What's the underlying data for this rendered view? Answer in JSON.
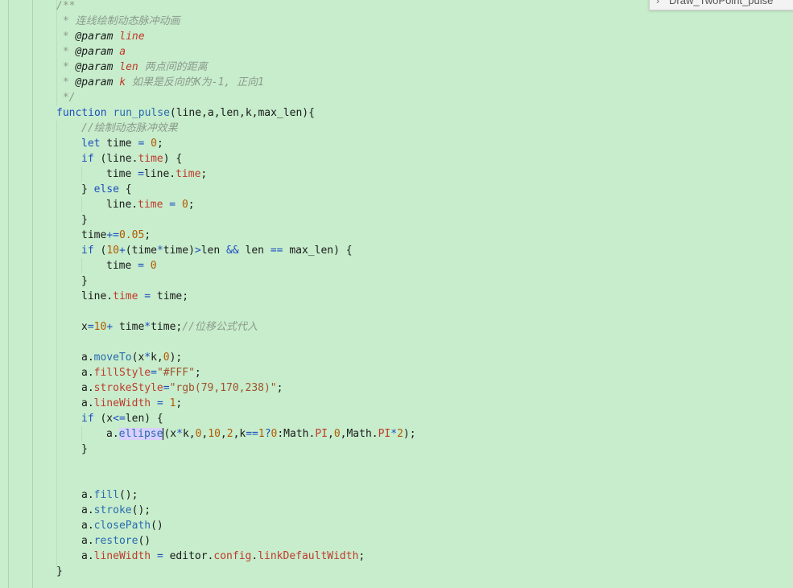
{
  "tab": {
    "chevron_icon": "chevron-right-icon",
    "title": "Draw_TwoPoint_pulse"
  },
  "code_lines": [
    [
      {
        "t": "/**",
        "c": "comment"
      }
    ],
    [
      {
        "t": " * 连线绘制动态脉冲动画",
        "c": "comment"
      }
    ],
    [
      {
        "t": " * ",
        "c": "comment"
      },
      {
        "t": "@param",
        "c": "tag"
      },
      {
        "t": " ",
        "c": "comment"
      },
      {
        "t": "line",
        "c": "param"
      }
    ],
    [
      {
        "t": " * ",
        "c": "comment"
      },
      {
        "t": "@param",
        "c": "tag"
      },
      {
        "t": " ",
        "c": "comment"
      },
      {
        "t": "a",
        "c": "param"
      }
    ],
    [
      {
        "t": " * ",
        "c": "comment"
      },
      {
        "t": "@param",
        "c": "tag"
      },
      {
        "t": " ",
        "c": "comment"
      },
      {
        "t": "len",
        "c": "param"
      },
      {
        "t": " 两点间的距离",
        "c": "comment"
      }
    ],
    [
      {
        "t": " * ",
        "c": "comment"
      },
      {
        "t": "@param",
        "c": "tag"
      },
      {
        "t": " ",
        "c": "comment"
      },
      {
        "t": "k",
        "c": "param"
      },
      {
        "t": " 如果是反向的K为-1, 正向1",
        "c": "comment"
      }
    ],
    [
      {
        "t": " */",
        "c": "comment"
      }
    ],
    [
      {
        "t": "function",
        "c": "kw"
      },
      {
        "t": " ",
        "c": "plain"
      },
      {
        "t": "run_pulse",
        "c": "fn"
      },
      {
        "t": "(line,a,len,k,max_len){",
        "c": "plain"
      }
    ],
    [
      {
        "t": "//绘制动态脉冲效果",
        "c": "comment"
      }
    ],
    [
      {
        "t": "let",
        "c": "kw"
      },
      {
        "t": " time ",
        "c": "plain"
      },
      {
        "t": "=",
        "c": "op"
      },
      {
        "t": " ",
        "c": "plain"
      },
      {
        "t": "0",
        "c": "num"
      },
      {
        "t": ";",
        "c": "plain"
      }
    ],
    [
      {
        "t": "if",
        "c": "kw"
      },
      {
        "t": " (line.",
        "c": "plain"
      },
      {
        "t": "time",
        "c": "prop"
      },
      {
        "t": ") {",
        "c": "plain"
      }
    ],
    [
      {
        "t": "time ",
        "c": "plain"
      },
      {
        "t": "=",
        "c": "op"
      },
      {
        "t": "line.",
        "c": "plain"
      },
      {
        "t": "time",
        "c": "prop"
      },
      {
        "t": ";",
        "c": "plain"
      }
    ],
    [
      {
        "t": "} ",
        "c": "plain"
      },
      {
        "t": "else",
        "c": "kw"
      },
      {
        "t": " {",
        "c": "plain"
      }
    ],
    [
      {
        "t": "line.",
        "c": "plain"
      },
      {
        "t": "time",
        "c": "prop"
      },
      {
        "t": " ",
        "c": "plain"
      },
      {
        "t": "=",
        "c": "op"
      },
      {
        "t": " ",
        "c": "plain"
      },
      {
        "t": "0",
        "c": "num"
      },
      {
        "t": ";",
        "c": "plain"
      }
    ],
    [
      {
        "t": "}",
        "c": "plain"
      }
    ],
    [
      {
        "t": "time",
        "c": "plain"
      },
      {
        "t": "+=",
        "c": "op"
      },
      {
        "t": "0.05",
        "c": "num"
      },
      {
        "t": ";",
        "c": "plain"
      }
    ],
    [
      {
        "t": "if",
        "c": "kw"
      },
      {
        "t": " (",
        "c": "plain"
      },
      {
        "t": "10",
        "c": "num"
      },
      {
        "t": "+",
        "c": "op"
      },
      {
        "t": "(time",
        "c": "plain"
      },
      {
        "t": "*",
        "c": "op"
      },
      {
        "t": "time)",
        "c": "plain"
      },
      {
        "t": ">",
        "c": "op"
      },
      {
        "t": "len ",
        "c": "plain"
      },
      {
        "t": "&&",
        "c": "op"
      },
      {
        "t": " len ",
        "c": "plain"
      },
      {
        "t": "==",
        "c": "op"
      },
      {
        "t": " max_len) {",
        "c": "plain"
      }
    ],
    [
      {
        "t": "time ",
        "c": "plain"
      },
      {
        "t": "=",
        "c": "op"
      },
      {
        "t": " ",
        "c": "plain"
      },
      {
        "t": "0",
        "c": "num"
      }
    ],
    [
      {
        "t": "}",
        "c": "plain"
      }
    ],
    [
      {
        "t": "line.",
        "c": "plain"
      },
      {
        "t": "time",
        "c": "prop"
      },
      {
        "t": " ",
        "c": "plain"
      },
      {
        "t": "=",
        "c": "op"
      },
      {
        "t": " time;",
        "c": "plain"
      }
    ],
    [],
    [
      {
        "t": "x",
        "c": "plain"
      },
      {
        "t": "=",
        "c": "op"
      },
      {
        "t": "10",
        "c": "num"
      },
      {
        "t": "+",
        "c": "op"
      },
      {
        "t": " time",
        "c": "plain"
      },
      {
        "t": "*",
        "c": "op"
      },
      {
        "t": "time;",
        "c": "plain"
      },
      {
        "t": "//位移公式代入",
        "c": "comment"
      }
    ],
    [],
    [
      {
        "t": "a.",
        "c": "plain"
      },
      {
        "t": "moveTo",
        "c": "fn"
      },
      {
        "t": "(x",
        "c": "plain"
      },
      {
        "t": "*",
        "c": "op"
      },
      {
        "t": "k,",
        "c": "plain"
      },
      {
        "t": "0",
        "c": "num"
      },
      {
        "t": ");",
        "c": "plain"
      }
    ],
    [
      {
        "t": "a.",
        "c": "plain"
      },
      {
        "t": "fillStyle",
        "c": "prop"
      },
      {
        "t": "=",
        "c": "op"
      },
      {
        "t": "\"#FFF\"",
        "c": "str"
      },
      {
        "t": ";",
        "c": "plain"
      }
    ],
    [
      {
        "t": "a.",
        "c": "plain"
      },
      {
        "t": "strokeStyle",
        "c": "prop"
      },
      {
        "t": "=",
        "c": "op"
      },
      {
        "t": "\"rgb(79,170,238)\"",
        "c": "str"
      },
      {
        "t": ";",
        "c": "plain"
      }
    ],
    [
      {
        "t": "a.",
        "c": "plain"
      },
      {
        "t": "lineWidth",
        "c": "prop"
      },
      {
        "t": " ",
        "c": "plain"
      },
      {
        "t": "=",
        "c": "op"
      },
      {
        "t": " ",
        "c": "plain"
      },
      {
        "t": "1",
        "c": "num"
      },
      {
        "t": ";",
        "c": "plain"
      }
    ],
    [
      {
        "t": "if",
        "c": "kw"
      },
      {
        "t": " (x",
        "c": "plain"
      },
      {
        "t": "<=",
        "c": "op"
      },
      {
        "t": "len) {",
        "c": "plain"
      }
    ],
    [
      {
        "t": "a.",
        "c": "plain"
      },
      {
        "t": "ellipse",
        "c": "highlight"
      },
      {
        "t": "",
        "c": "cursor"
      },
      {
        "t": "(x",
        "c": "plain"
      },
      {
        "t": "*",
        "c": "op"
      },
      {
        "t": "k,",
        "c": "plain"
      },
      {
        "t": "0",
        "c": "num"
      },
      {
        "t": ",",
        "c": "plain"
      },
      {
        "t": "10",
        "c": "num"
      },
      {
        "t": ",",
        "c": "plain"
      },
      {
        "t": "2",
        "c": "num"
      },
      {
        "t": ",k",
        "c": "plain"
      },
      {
        "t": "==",
        "c": "op"
      },
      {
        "t": "1",
        "c": "num"
      },
      {
        "t": "?",
        "c": "op"
      },
      {
        "t": "0",
        "c": "num"
      },
      {
        "t": ":Math.",
        "c": "plain"
      },
      {
        "t": "PI",
        "c": "prop"
      },
      {
        "t": ",",
        "c": "plain"
      },
      {
        "t": "0",
        "c": "num"
      },
      {
        "t": ",Math.",
        "c": "plain"
      },
      {
        "t": "PI",
        "c": "prop"
      },
      {
        "t": "*",
        "c": "op"
      },
      {
        "t": "2",
        "c": "num"
      },
      {
        "t": ");",
        "c": "plain"
      }
    ],
    [
      {
        "t": "}",
        "c": "plain"
      }
    ],
    [],
    [],
    [
      {
        "t": "a.",
        "c": "plain"
      },
      {
        "t": "fill",
        "c": "fn"
      },
      {
        "t": "();",
        "c": "plain"
      }
    ],
    [
      {
        "t": "a.",
        "c": "plain"
      },
      {
        "t": "stroke",
        "c": "fn"
      },
      {
        "t": "();",
        "c": "plain"
      }
    ],
    [
      {
        "t": "a.",
        "c": "plain"
      },
      {
        "t": "closePath",
        "c": "fn"
      },
      {
        "t": "()",
        "c": "plain"
      }
    ],
    [
      {
        "t": "a.",
        "c": "plain"
      },
      {
        "t": "restore",
        "c": "fn"
      },
      {
        "t": "()",
        "c": "plain"
      }
    ],
    [
      {
        "t": "a.",
        "c": "plain"
      },
      {
        "t": "lineWidth",
        "c": "prop"
      },
      {
        "t": " ",
        "c": "plain"
      },
      {
        "t": "=",
        "c": "op"
      },
      {
        "t": " editor.",
        "c": "plain"
      },
      {
        "t": "config",
        "c": "prop"
      },
      {
        "t": ".",
        "c": "plain"
      },
      {
        "t": "linkDefaultWidth",
        "c": "prop"
      },
      {
        "t": ";",
        "c": "plain"
      }
    ],
    [
      {
        "t": "}",
        "c": "plain"
      }
    ]
  ]
}
